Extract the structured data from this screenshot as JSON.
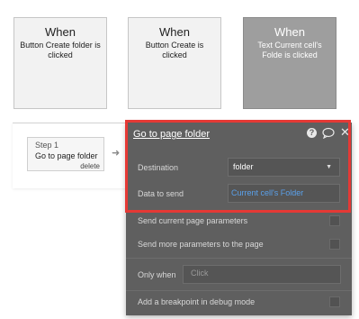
{
  "events": [
    {
      "when": "When",
      "desc": "Button Create folder is clicked"
    },
    {
      "when": "When",
      "desc": "Button Create is clicked"
    },
    {
      "when": "When",
      "desc": "Text Current cell's Folde is clicked"
    }
  ],
  "step": {
    "number": "Step 1",
    "title": "Go to page folder",
    "delete": "delete"
  },
  "panel": {
    "title": "Go to page folder",
    "icons": [
      "help-icon",
      "comment-icon",
      "close-icon"
    ],
    "destination_label": "Destination",
    "destination_value": "folder",
    "data_label": "Data to send",
    "data_value": "Current cell's Folder",
    "send_current_label": "Send current page parameters",
    "send_more_label": "Send more parameters to the page",
    "only_when_label": "Only when",
    "only_when_placeholder": "Click",
    "breakpoint_label": "Add a breakpoint in debug mode"
  },
  "colors": {
    "highlight": "#e53935",
    "panel": "#5f5f5f",
    "link": "#5aa0ea"
  }
}
